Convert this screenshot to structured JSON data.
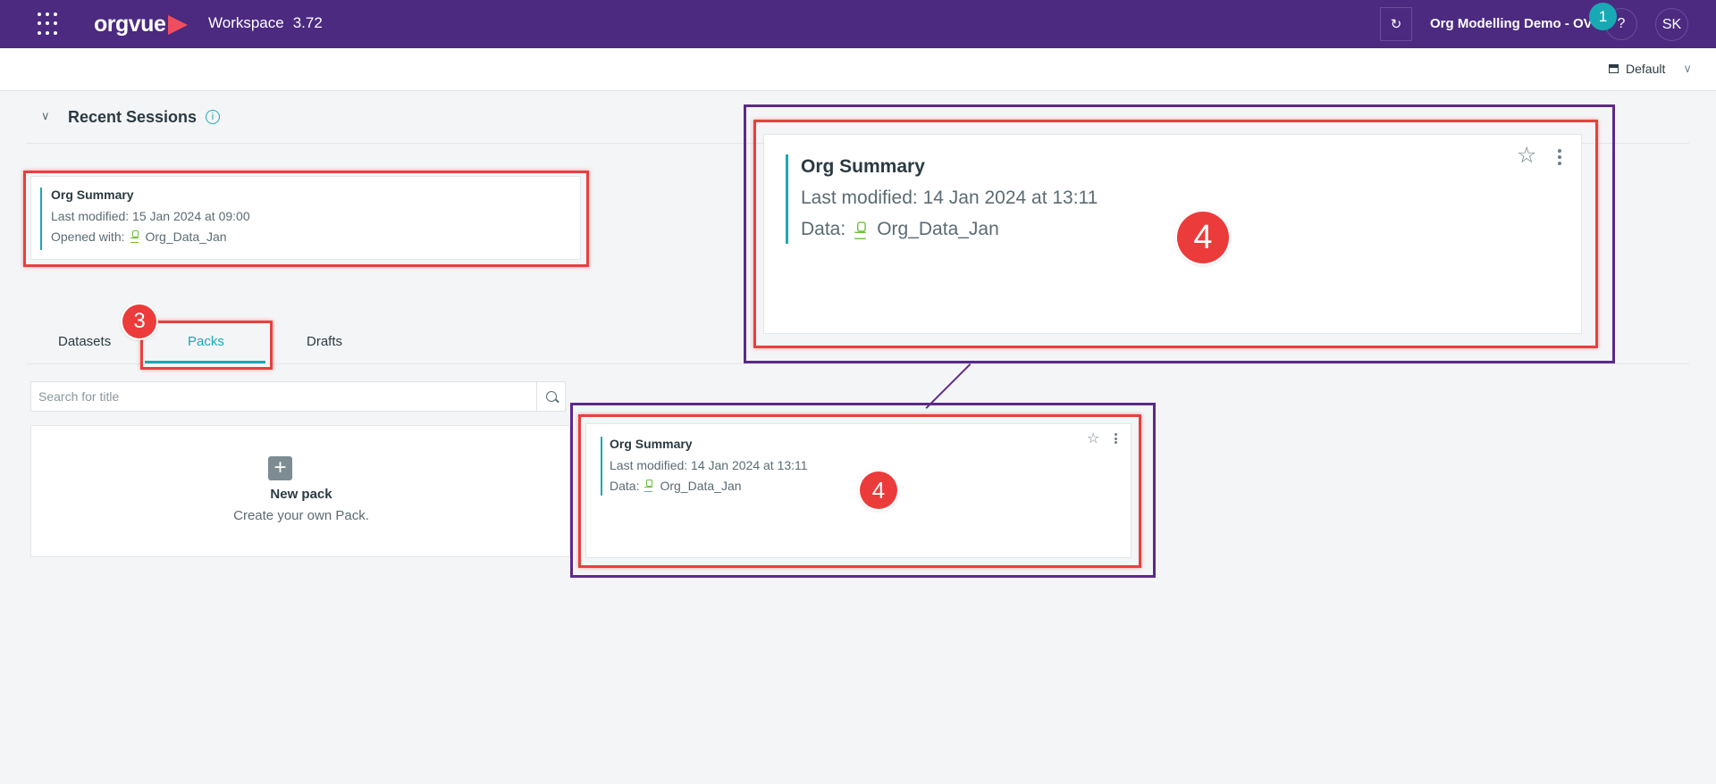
{
  "header": {
    "app_title": "Workspace",
    "version": "3.72",
    "project_name": "Org Modelling Demo - OV",
    "help_label": "?",
    "avatar_initials": "SK",
    "notification_count": "1",
    "logo_text": "orgvue",
    "theme_color": "#4b2a80"
  },
  "subbar": {
    "layout_label": "Default"
  },
  "recent_sessions": {
    "title": "Recent Sessions",
    "info_label": "i",
    "cards": [
      {
        "title": "Org Summary",
        "last_modified": "Last modified: 15 Jan 2024 at 09:00",
        "opened_with_prefix": "Opened with:",
        "dataset": "Org_Data_Jan"
      }
    ]
  },
  "tabs": {
    "items": [
      {
        "label": "Datasets"
      },
      {
        "label": "Packs"
      },
      {
        "label": "Drafts"
      }
    ],
    "active": "Packs"
  },
  "search": {
    "placeholder": "Search for title"
  },
  "new_pack": {
    "title": "New pack",
    "description": "Create your own Pack."
  },
  "pack_cards": [
    {
      "title": "Org Summary",
      "last_modified": "Last modified: 14 Jan 2024 at 13:11",
      "data_prefix": "Data:",
      "dataset": "Org_Data_Jan"
    }
  ],
  "annotations": {
    "step_3": "3",
    "step_4": "4",
    "highlight_color": "#e8403e",
    "zoom_frame_color": "#5c2a8a",
    "accent_color": "#19a9b4"
  }
}
